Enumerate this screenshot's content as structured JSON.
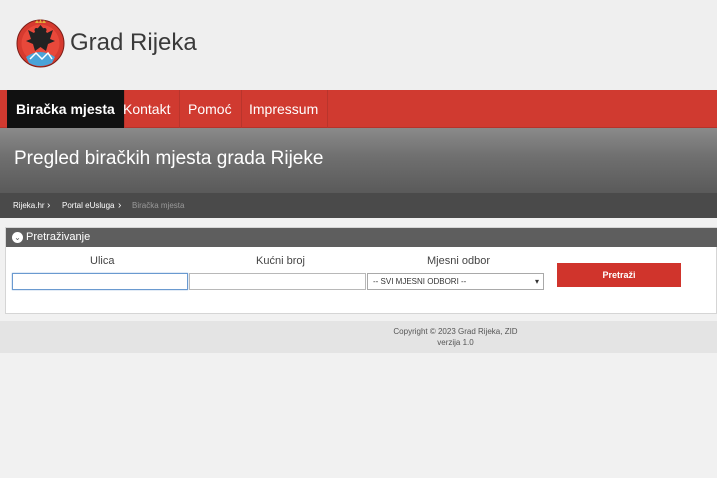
{
  "site": {
    "title": "Grad Rijeka",
    "logo": "coat-of-arms-logo"
  },
  "nav": {
    "items": [
      {
        "label": "Biračka mjesta",
        "active": true
      },
      {
        "label": "Kontakt"
      },
      {
        "label": "Pomoć"
      },
      {
        "label": "Impressum"
      }
    ]
  },
  "banner": {
    "title": "Pregled biračkih mjesta grada Rijeke"
  },
  "breadcrumb": {
    "items": [
      "Rijeka.hr",
      "Portal eUsluga",
      "Biračka mjesta"
    ],
    "separator_icon": "chevron-right-icon"
  },
  "search": {
    "panel_title": "Pretraživanje",
    "toggle_icon": "chevron-down-circle-icon",
    "street_label": "Ulica",
    "street_value": "",
    "house_label": "Kućni broj",
    "house_value": "",
    "district_label": "Mjesni odbor",
    "district_selected": "-- SVI MJESNI ODBORI --",
    "button_label": "Pretraži"
  },
  "footer": {
    "copyright": "Copyright © 2023 Grad Rijeka, ZID",
    "version": "verzija 1.0"
  },
  "colors": {
    "nav_red": "#d03a30",
    "active_tab": "#111111",
    "button_red": "#d0342c"
  }
}
